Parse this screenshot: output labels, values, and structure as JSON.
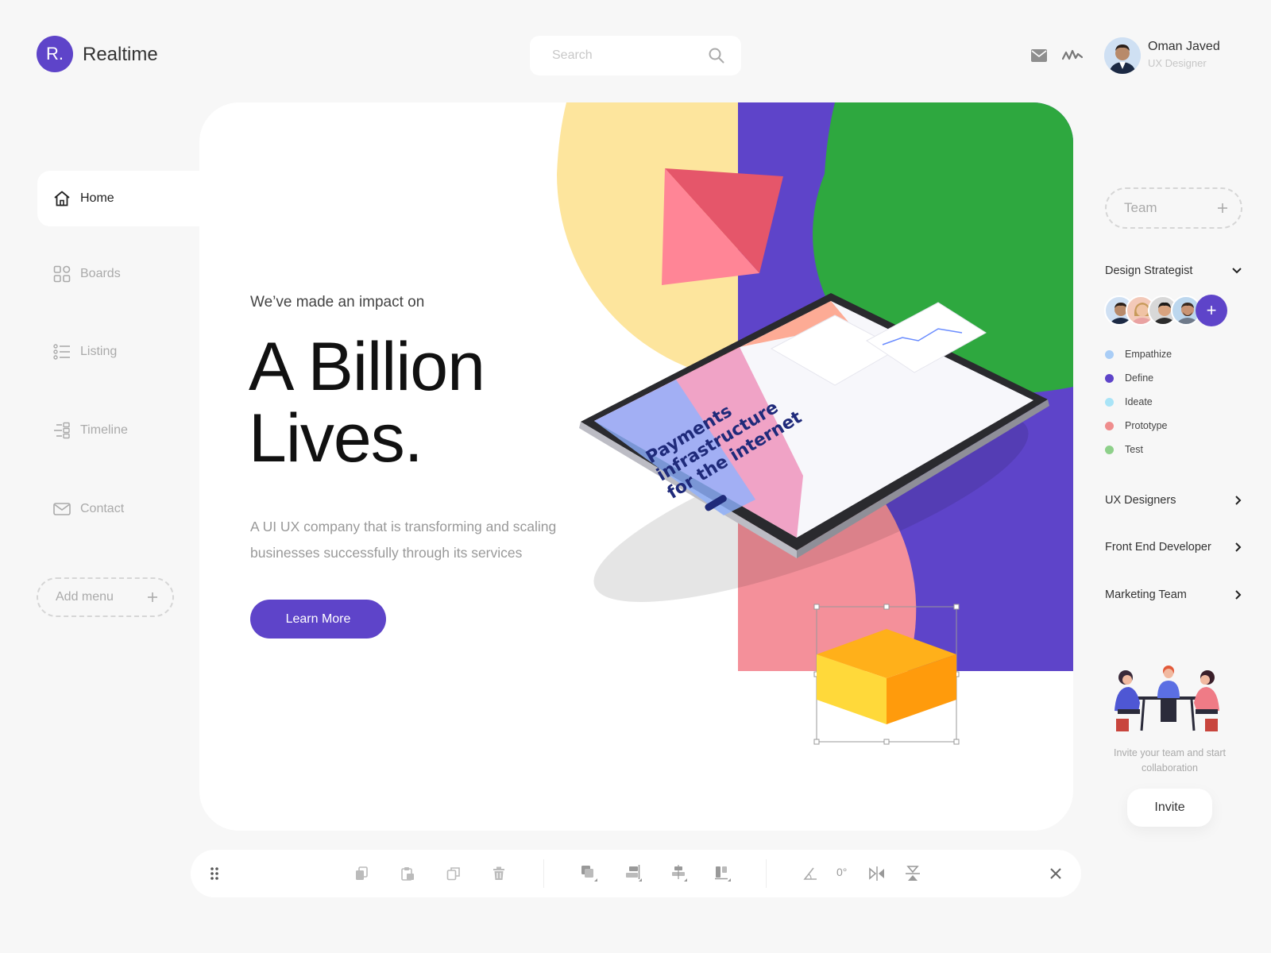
{
  "brand": {
    "logo_letter": "R.",
    "name": "Realtime",
    "accent_color": "#5e44c9"
  },
  "header": {
    "search_placeholder": "Search",
    "user": {
      "name": "Oman Javed",
      "role": "UX Designer"
    }
  },
  "sidebar": {
    "items": [
      {
        "label": "Home",
        "icon": "home-icon",
        "active": true
      },
      {
        "label": "Boards",
        "icon": "boards-icon",
        "active": false
      },
      {
        "label": "Listing",
        "icon": "listing-icon",
        "active": false
      },
      {
        "label": "Timeline",
        "icon": "timeline-icon",
        "active": false
      },
      {
        "label": "Contact",
        "icon": "mail-icon",
        "active": false
      }
    ],
    "add_menu_label": "Add menu"
  },
  "hero": {
    "subtitle": "We’ve made an impact on",
    "title_line1": "A Billion",
    "title_line2": "Lives.",
    "description": "A UI UX company that is transforming and scaling businesses successfully through its services",
    "cta_label": "Learn More",
    "tablet_headline": "Payments infrastructure for the internet",
    "colors": {
      "yellow": "#fde59d",
      "purple": "#5e44c9",
      "green": "#2ea83f",
      "pink": "#f4909a",
      "cube_yellow": "#ffd93a",
      "cube_orange": "#ff9b0c"
    }
  },
  "toolbar": {
    "rotation_value": "0°"
  },
  "right_panel": {
    "team_label": "Team",
    "group_title": "Design Strategist",
    "phases": [
      {
        "label": "Empathize",
        "color": "#a9cdf6"
      },
      {
        "label": "Define",
        "color": "#5e44c9"
      },
      {
        "label": "Ideate",
        "color": "#a9e4f7"
      },
      {
        "label": "Prototype",
        "color": "#ef8d8d"
      },
      {
        "label": "Test",
        "color": "#8ed08a"
      }
    ],
    "groups": [
      "UX Designers",
      "Front End Developer",
      "Marketing Team"
    ],
    "invite_text": "Invite your team and start collaboration",
    "invite_label": "Invite"
  }
}
